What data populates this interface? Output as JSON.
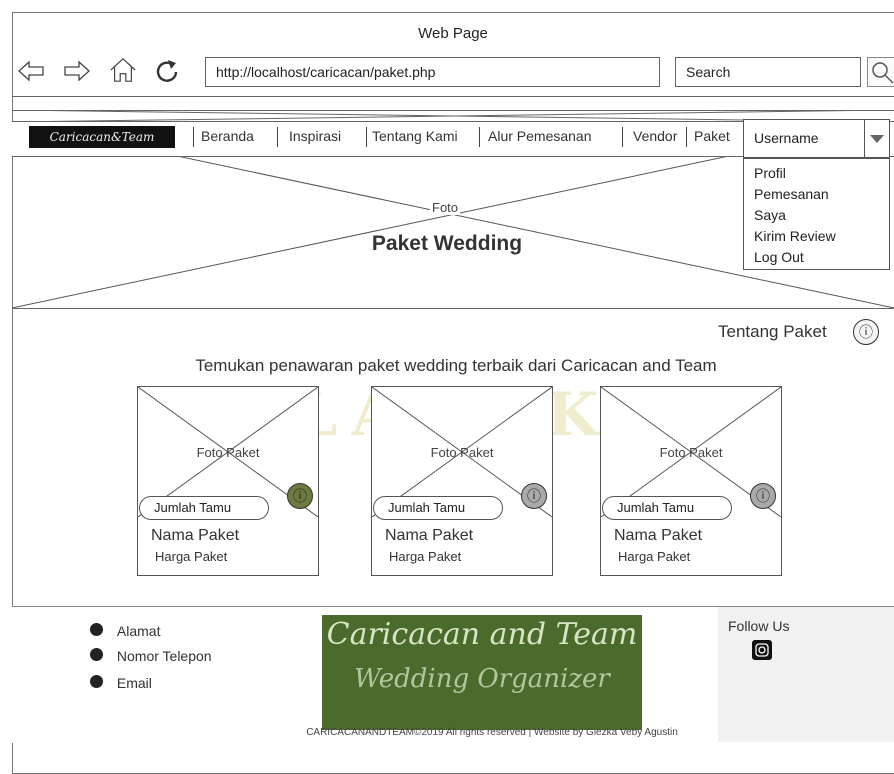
{
  "window": {
    "title": "Web Page"
  },
  "browser": {
    "url": "http://localhost/caricacan/paket.php",
    "search_placeholder": "Search"
  },
  "nav": {
    "logo_text": "Caricacan&Team",
    "items": [
      "Beranda",
      "Inspirasi",
      "Tentang Kami",
      "Alur Pemesanan",
      "Vendor",
      "Paket"
    ]
  },
  "user_menu": {
    "selected": "Username",
    "options": [
      "Profil",
      "Pemesanan",
      "Saya",
      "Kirim Review",
      "Log Out"
    ]
  },
  "hero": {
    "image_label": "Foto",
    "title": "Paket Wedding"
  },
  "main": {
    "about_label": "Tentang Paket",
    "tagline": "Temukan penawaran paket wedding terbaik dari Caricacan and Team",
    "cards": [
      {
        "image_label": "Foto Paket",
        "guests_label": "Jumlah Tamu",
        "name": "Nama Paket",
        "price": "Harga Paket"
      },
      {
        "image_label": "Foto Paket",
        "guests_label": "Jumlah Tamu",
        "name": "Nama Paket",
        "price": "Harga Paket"
      },
      {
        "image_label": "Foto Paket",
        "guests_label": "Jumlah Tamu",
        "name": "Nama Paket",
        "price": "Harga Paket"
      }
    ]
  },
  "footer": {
    "address": "Alamat",
    "phone": "Nomor Telepon",
    "email": "Email",
    "logo_line1": "Caricacan and Team",
    "logo_line2": "Wedding Organizer",
    "follow": "Follow Us",
    "copyright": "CARICACANANDTEAM©2019 All rights reserved | Website by Giezka Veby Agustin"
  },
  "colors": {
    "accent_logo_bg": "#4a6b2c",
    "footer_side_bg": "#f1f1f1"
  },
  "icons": [
    "back-arrow-icon",
    "forward-arrow-icon",
    "home-icon",
    "reload-icon",
    "search-icon",
    "dropdown-arrow-icon",
    "info-icon",
    "location-icon",
    "phone-icon",
    "email-icon",
    "instagram-icon"
  ]
}
